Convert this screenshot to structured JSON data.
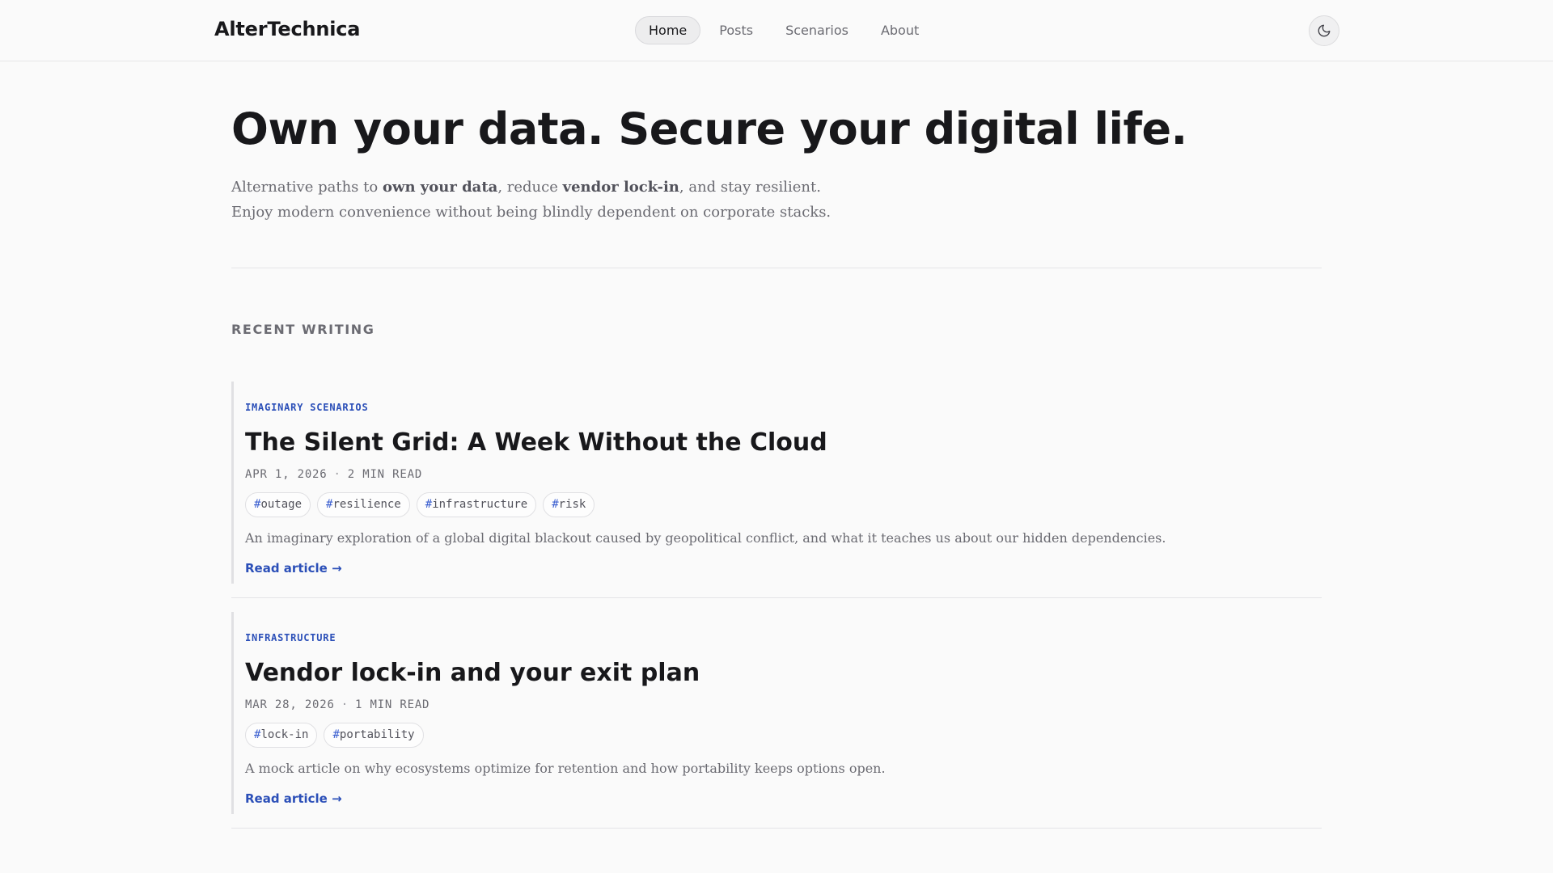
{
  "header": {
    "brand": "AlterTechnica",
    "nav": [
      {
        "label": "Home",
        "active": true
      },
      {
        "label": "Posts",
        "active": false
      },
      {
        "label": "Scenarios",
        "active": false
      },
      {
        "label": "About",
        "active": false
      }
    ],
    "theme_toggle_icon": "moon-icon"
  },
  "hero": {
    "title": "Own your data. Secure your digital life.",
    "subtitle_parts": [
      {
        "text": "Alternative paths to ",
        "bold": false
      },
      {
        "text": "own your data",
        "bold": true
      },
      {
        "text": ", reduce ",
        "bold": false
      },
      {
        "text": "vendor lock-in",
        "bold": true
      },
      {
        "text": ", and stay resilient. Enjoy modern convenience without being blindly dependent on corporate stacks.",
        "bold": false
      }
    ]
  },
  "section": {
    "label": "RECENT WRITING"
  },
  "posts": [
    {
      "category": "IMAGINARY SCENARIOS",
      "title": "The Silent Grid: A Week Without the Cloud",
      "date": "APR 1, 2026",
      "read_time": "2 MIN READ",
      "tags": [
        "outage",
        "resilience",
        "infrastructure",
        "risk"
      ],
      "excerpt": "An imaginary exploration of a global digital blackout caused by geopolitical conflict, and what it teaches us about our hidden dependencies.",
      "link": "Read article →"
    },
    {
      "category": "INFRASTRUCTURE",
      "title": "Vendor lock-in and your exit plan",
      "date": "MAR 28, 2026",
      "read_time": "1 MIN READ",
      "tags": [
        "lock-in",
        "portability"
      ],
      "excerpt": "A mock article on why ecosystems optimize for retention and how portability keeps options open.",
      "link": "Read article →"
    }
  ],
  "colors": {
    "accent": "#2b4fb8",
    "background": "#fafafa",
    "text": "#18181b",
    "muted": "#6b6b72"
  }
}
